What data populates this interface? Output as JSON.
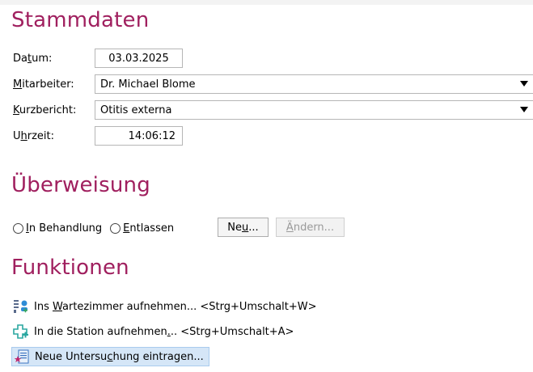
{
  "stammdaten": {
    "title": "Stammdaten",
    "datum_label_pre": "Da",
    "datum_label_u": "t",
    "datum_label_post": "um:",
    "datum_value": "03.03.2025",
    "mitarbeiter_label_u": "M",
    "mitarbeiter_label_post": "itarbeiter:",
    "mitarbeiter_value": "Dr. Michael Blome",
    "kurzbericht_label_u": "K",
    "kurzbericht_label_post": "urzbericht:",
    "kurzbericht_value": "Otitis externa",
    "uhrzeit_label_pre": "U",
    "uhrzeit_label_u": "h",
    "uhrzeit_label_post": "rzeit:",
    "uhrzeit_value": "14:06:12"
  },
  "ueberweisung": {
    "title": "Überweisung",
    "radio1_u": "I",
    "radio1_post": "n Behandlung",
    "radio2_u": "E",
    "radio2_post": "ntlassen",
    "new_pre": "Ne",
    "new_u": "u",
    "new_post": "...",
    "edit_u": "Ä",
    "edit_post": "ndern..."
  },
  "funktionen": {
    "title": "Funktionen",
    "item1_pre": "Ins ",
    "item1_u": "W",
    "item1_post": "artezimmer aufnehmen... <Strg+Umschalt+W>",
    "item2_pre": "In die Station aufnehmen",
    "item2_u": ".",
    "item2_post": ".. <Strg+Umschalt+A>",
    "item3_pre": "Neue Untersu",
    "item3_u": "c",
    "item3_post": "hung eintragen..."
  },
  "colors": {
    "section_title": "#a0205f",
    "selection_bg": "#d5e6f7"
  },
  "icons": [
    "waiting-room-icon",
    "station-plus-icon",
    "new-examination-icon",
    "combo-arrow-icon"
  ]
}
